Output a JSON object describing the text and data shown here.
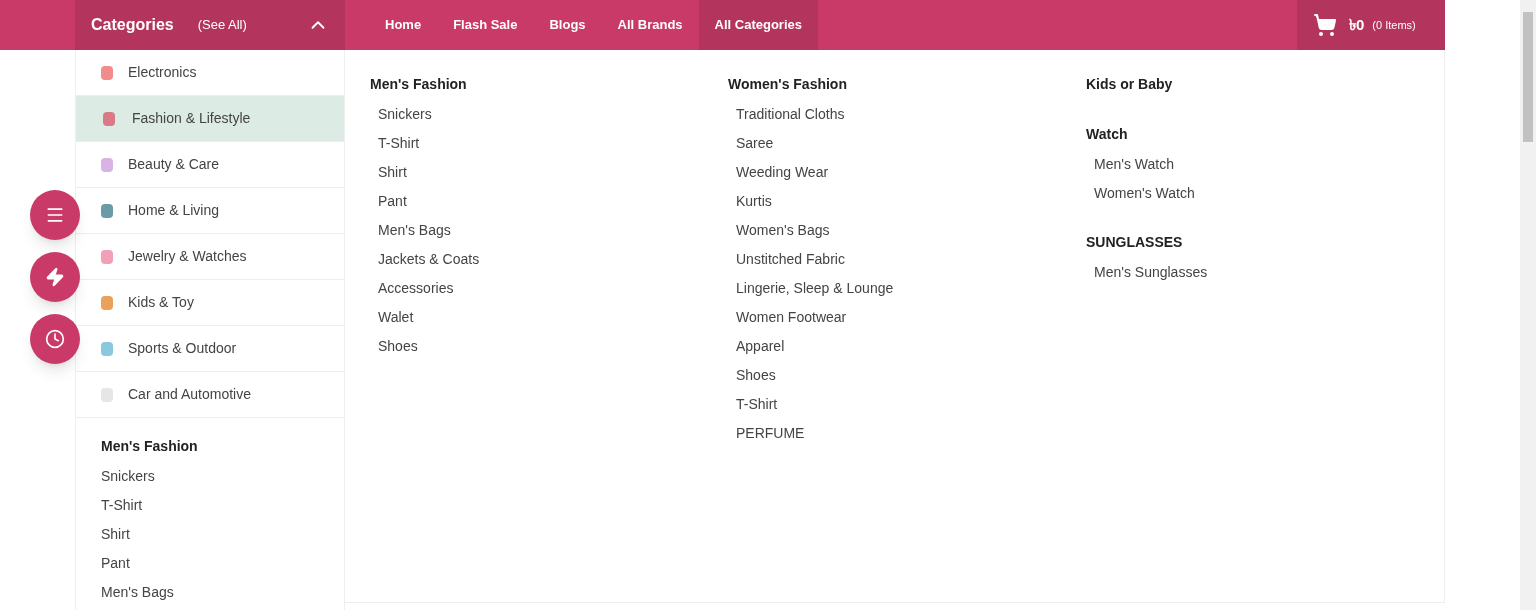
{
  "header": {
    "categories_title": "Categories",
    "see_all": "(See All)",
    "expanded": true
  },
  "nav": [
    {
      "label": "Home",
      "selected": false
    },
    {
      "label": "Flash Sale",
      "selected": false
    },
    {
      "label": "Blogs",
      "selected": false
    },
    {
      "label": "All Brands",
      "selected": false
    },
    {
      "label": "All Categories",
      "selected": true
    }
  ],
  "cart": {
    "amount": "৳0",
    "items": "(0 Items)"
  },
  "sidebar": {
    "items": [
      {
        "label": "Electronics",
        "selected": false
      },
      {
        "label": "Fashion & Lifestyle",
        "selected": true
      },
      {
        "label": "Beauty & Care",
        "selected": false
      },
      {
        "label": "Home & Living",
        "selected": false
      },
      {
        "label": "Jewelry & Watches",
        "selected": false
      },
      {
        "label": "Kids & Toy",
        "selected": false
      },
      {
        "label": "Sports & Outdoor",
        "selected": false
      },
      {
        "label": "Car and Automotive",
        "selected": false
      }
    ],
    "submenu": {
      "title": "Men's Fashion",
      "items": [
        "Snickers",
        "T-Shirt",
        "Shirt",
        "Pant",
        "Men's Bags"
      ]
    }
  },
  "mega_menu": {
    "columns": [
      {
        "groups": [
          {
            "title": "Men's Fashion",
            "items": [
              "Snickers",
              "T-Shirt",
              "Shirt",
              "Pant",
              "Men's Bags",
              "Jackets & Coats",
              "Accessories",
              "Walet",
              "Shoes"
            ]
          }
        ]
      },
      {
        "groups": [
          {
            "title": "Women's Fashion",
            "items": [
              "Traditional Cloths",
              "Saree",
              "Weeding Wear",
              "Kurtis",
              "Women's Bags",
              "Unstitched Fabric",
              "Lingerie, Sleep & Lounge",
              "Women Footwear",
              "Apparel",
              "Shoes",
              "T-Shirt",
              "PERFUME"
            ]
          }
        ]
      },
      {
        "groups": [
          {
            "title": "Kids or Baby"
          },
          {
            "title": "Watch",
            "items": [
              "Men's Watch",
              "Women's Watch"
            ]
          },
          {
            "title": "SUNGLASSES",
            "items": [
              "Men's Sunglasses"
            ]
          }
        ]
      }
    ]
  }
}
